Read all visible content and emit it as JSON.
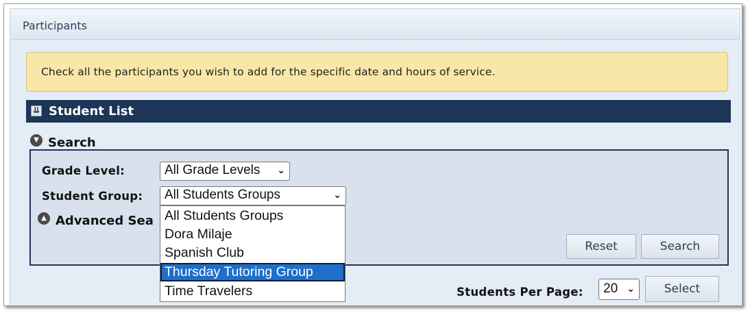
{
  "panel": {
    "title": "Participants"
  },
  "notice": {
    "text": "Check all the participants you wish to add for the specific date and hours of service."
  },
  "student_list": {
    "title": "Student List"
  },
  "search": {
    "title": "Search",
    "grade_level": {
      "label": "Grade Level:",
      "value": "All Grade Levels"
    },
    "student_group": {
      "label": "Student Group:",
      "value": "All Students Groups",
      "options": [
        "All Students Groups",
        "Dora Milaje",
        "Spanish Club",
        "Thursday Tutoring Group",
        "Time Travelers"
      ],
      "highlighted_option": "Thursday Tutoring Group"
    },
    "advanced_search_visible": "Advanced Sea",
    "reset_label": "Reset",
    "search_label": "Search"
  },
  "pagination": {
    "per_page_label": "Students Per Page:",
    "per_page_value": "20",
    "select_label": "Select"
  },
  "colors": {
    "header_bar": "#1d3557",
    "notice_bg": "#f8e7a7",
    "highlight": "#1e6fc9"
  },
  "icons": {
    "collapse": "collapse-icon",
    "search_toggle": "chevron-down-circle-icon",
    "advanced_toggle": "chevron-up-circle-icon",
    "select_arrow": "chevron-down-icon"
  }
}
